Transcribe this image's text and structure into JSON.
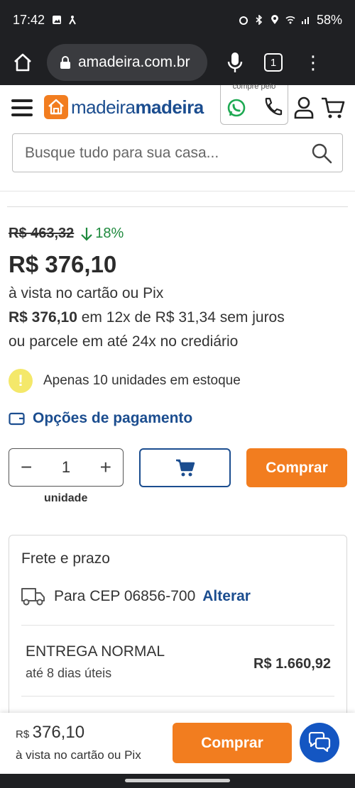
{
  "status_bar": {
    "time": "17:42",
    "battery": "58%"
  },
  "browser": {
    "url": "amadeira.com.br",
    "tab_count": "1"
  },
  "header": {
    "logo_light": "madeira",
    "logo_bold": "madeira",
    "compre_label": "compre pelo",
    "search_placeholder": "Busque tudo para sua casa..."
  },
  "product": {
    "old_price": "R$ 463,32",
    "discount": "18%",
    "price": "R$ 376,10",
    "cash_note": "à vista no cartão ou Pix",
    "installment_bold": "R$ 376,10",
    "installment_rest": " em 12x de R$ 31,34 sem juros",
    "credit_note": "ou parcele em até 24x no crediário",
    "stock_warning": "Apenas 10 unidades em estoque",
    "payment_options": "Opções de pagamento",
    "quantity": "1",
    "quantity_label": "unidade",
    "buy_label": "Comprar"
  },
  "shipping": {
    "title": "Frete e prazo",
    "cep_text": "Para CEP 06856-700",
    "change_label": "Alterar",
    "option_name": "ENTREGA NORMAL",
    "option_days": "até 8 dias úteis",
    "option_price": "R$ 1.660,92"
  },
  "bottom_bar": {
    "currency": "R$",
    "price": "376,10",
    "note": "à vista no cartão ou Pix",
    "buy_label": "Comprar"
  },
  "colors": {
    "brand_orange": "#f27d1f",
    "brand_blue": "#1b4d8f",
    "discount_green": "#1f8a3e",
    "chat_blue": "#1456c2"
  }
}
